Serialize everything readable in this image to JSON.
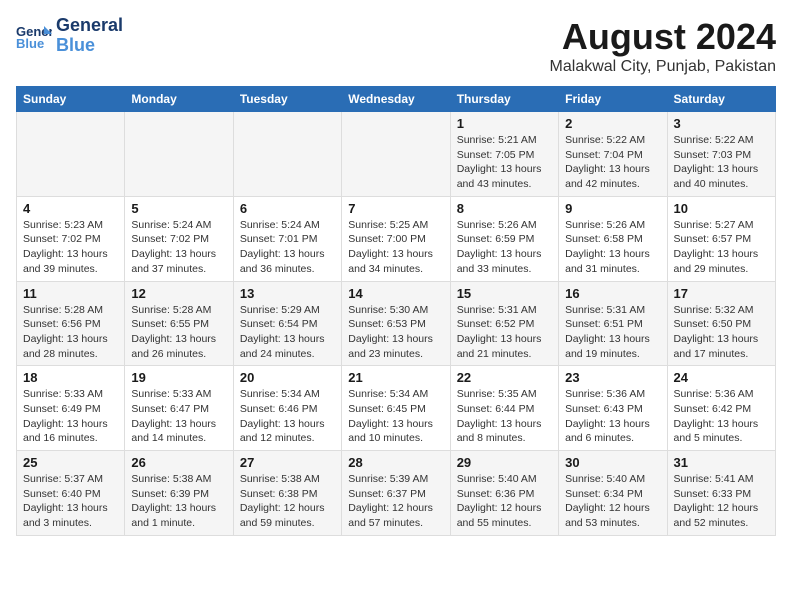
{
  "header": {
    "logo_line1": "General",
    "logo_line2": "Blue",
    "main_title": "August 2024",
    "subtitle": "Malakwal City, Punjab, Pakistan"
  },
  "weekdays": [
    "Sunday",
    "Monday",
    "Tuesday",
    "Wednesday",
    "Thursday",
    "Friday",
    "Saturday"
  ],
  "weeks": [
    [
      {
        "day": "",
        "info": ""
      },
      {
        "day": "",
        "info": ""
      },
      {
        "day": "",
        "info": ""
      },
      {
        "day": "",
        "info": ""
      },
      {
        "day": "1",
        "info": "Sunrise: 5:21 AM\nSunset: 7:05 PM\nDaylight: 13 hours\nand 43 minutes."
      },
      {
        "day": "2",
        "info": "Sunrise: 5:22 AM\nSunset: 7:04 PM\nDaylight: 13 hours\nand 42 minutes."
      },
      {
        "day": "3",
        "info": "Sunrise: 5:22 AM\nSunset: 7:03 PM\nDaylight: 13 hours\nand 40 minutes."
      }
    ],
    [
      {
        "day": "4",
        "info": "Sunrise: 5:23 AM\nSunset: 7:02 PM\nDaylight: 13 hours\nand 39 minutes."
      },
      {
        "day": "5",
        "info": "Sunrise: 5:24 AM\nSunset: 7:02 PM\nDaylight: 13 hours\nand 37 minutes."
      },
      {
        "day": "6",
        "info": "Sunrise: 5:24 AM\nSunset: 7:01 PM\nDaylight: 13 hours\nand 36 minutes."
      },
      {
        "day": "7",
        "info": "Sunrise: 5:25 AM\nSunset: 7:00 PM\nDaylight: 13 hours\nand 34 minutes."
      },
      {
        "day": "8",
        "info": "Sunrise: 5:26 AM\nSunset: 6:59 PM\nDaylight: 13 hours\nand 33 minutes."
      },
      {
        "day": "9",
        "info": "Sunrise: 5:26 AM\nSunset: 6:58 PM\nDaylight: 13 hours\nand 31 minutes."
      },
      {
        "day": "10",
        "info": "Sunrise: 5:27 AM\nSunset: 6:57 PM\nDaylight: 13 hours\nand 29 minutes."
      }
    ],
    [
      {
        "day": "11",
        "info": "Sunrise: 5:28 AM\nSunset: 6:56 PM\nDaylight: 13 hours\nand 28 minutes."
      },
      {
        "day": "12",
        "info": "Sunrise: 5:28 AM\nSunset: 6:55 PM\nDaylight: 13 hours\nand 26 minutes."
      },
      {
        "day": "13",
        "info": "Sunrise: 5:29 AM\nSunset: 6:54 PM\nDaylight: 13 hours\nand 24 minutes."
      },
      {
        "day": "14",
        "info": "Sunrise: 5:30 AM\nSunset: 6:53 PM\nDaylight: 13 hours\nand 23 minutes."
      },
      {
        "day": "15",
        "info": "Sunrise: 5:31 AM\nSunset: 6:52 PM\nDaylight: 13 hours\nand 21 minutes."
      },
      {
        "day": "16",
        "info": "Sunrise: 5:31 AM\nSunset: 6:51 PM\nDaylight: 13 hours\nand 19 minutes."
      },
      {
        "day": "17",
        "info": "Sunrise: 5:32 AM\nSunset: 6:50 PM\nDaylight: 13 hours\nand 17 minutes."
      }
    ],
    [
      {
        "day": "18",
        "info": "Sunrise: 5:33 AM\nSunset: 6:49 PM\nDaylight: 13 hours\nand 16 minutes."
      },
      {
        "day": "19",
        "info": "Sunrise: 5:33 AM\nSunset: 6:47 PM\nDaylight: 13 hours\nand 14 minutes."
      },
      {
        "day": "20",
        "info": "Sunrise: 5:34 AM\nSunset: 6:46 PM\nDaylight: 13 hours\nand 12 minutes."
      },
      {
        "day": "21",
        "info": "Sunrise: 5:34 AM\nSunset: 6:45 PM\nDaylight: 13 hours\nand 10 minutes."
      },
      {
        "day": "22",
        "info": "Sunrise: 5:35 AM\nSunset: 6:44 PM\nDaylight: 13 hours\nand 8 minutes."
      },
      {
        "day": "23",
        "info": "Sunrise: 5:36 AM\nSunset: 6:43 PM\nDaylight: 13 hours\nand 6 minutes."
      },
      {
        "day": "24",
        "info": "Sunrise: 5:36 AM\nSunset: 6:42 PM\nDaylight: 13 hours\nand 5 minutes."
      }
    ],
    [
      {
        "day": "25",
        "info": "Sunrise: 5:37 AM\nSunset: 6:40 PM\nDaylight: 13 hours\nand 3 minutes."
      },
      {
        "day": "26",
        "info": "Sunrise: 5:38 AM\nSunset: 6:39 PM\nDaylight: 13 hours\nand 1 minute."
      },
      {
        "day": "27",
        "info": "Sunrise: 5:38 AM\nSunset: 6:38 PM\nDaylight: 12 hours\nand 59 minutes."
      },
      {
        "day": "28",
        "info": "Sunrise: 5:39 AM\nSunset: 6:37 PM\nDaylight: 12 hours\nand 57 minutes."
      },
      {
        "day": "29",
        "info": "Sunrise: 5:40 AM\nSunset: 6:36 PM\nDaylight: 12 hours\nand 55 minutes."
      },
      {
        "day": "30",
        "info": "Sunrise: 5:40 AM\nSunset: 6:34 PM\nDaylight: 12 hours\nand 53 minutes."
      },
      {
        "day": "31",
        "info": "Sunrise: 5:41 AM\nSunset: 6:33 PM\nDaylight: 12 hours\nand 52 minutes."
      }
    ]
  ]
}
